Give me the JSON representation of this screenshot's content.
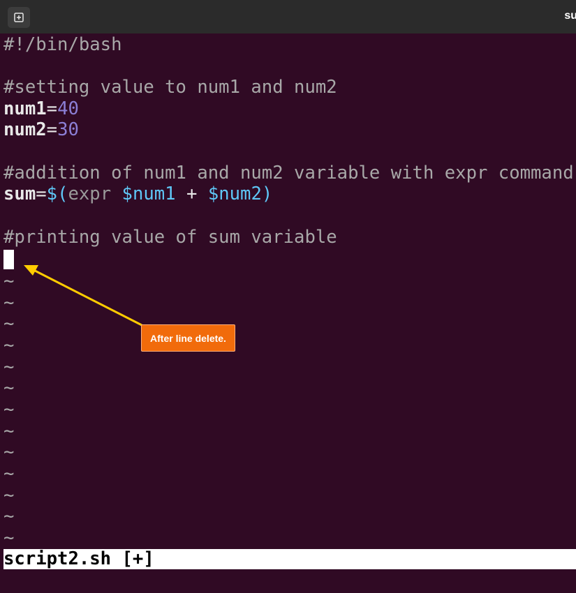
{
  "window": {
    "title": "su",
    "new_tab_icon": "new-tab-icon"
  },
  "editor": {
    "lines": {
      "shebang": "#!/bin/bash",
      "comment1": "#setting value to num1 and num2",
      "num1_name": "num1",
      "num1_eq": "=",
      "num1_value": "40",
      "num2_name": "num2",
      "num2_eq": "=",
      "num2_value": "30",
      "comment2": "#addition of num1 and num2 variable with expr command",
      "sum_name": "sum",
      "sum_eq": "=",
      "sum_open": "$(",
      "sum_cmd": "expr",
      "sum_space1": " ",
      "sum_arg1": "$num1",
      "sum_plus": " + ",
      "sum_arg2": "$num2",
      "sum_close": ")",
      "comment3": "#printing value of sum variable"
    },
    "tilde": "~",
    "status": "script2.sh [+]"
  },
  "annotation": {
    "label": "After line delete.",
    "color": "#f16b0b",
    "arrow_color": "#ffcc00"
  },
  "colors": {
    "terminal_bg": "#300a24",
    "titlebar_bg": "#2b2b2b"
  }
}
